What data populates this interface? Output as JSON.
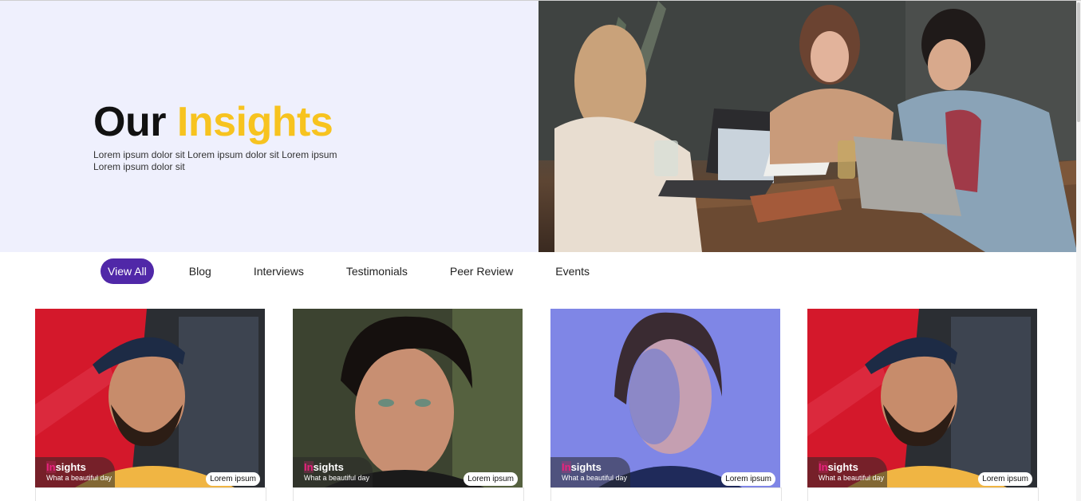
{
  "hero": {
    "title_prefix": "Our",
    "title_accent": "Insights",
    "description": "Lorem ipsum dolor sit Lorem ipsum dolor sit Lorem ipsum Lorem ipsum dolor sit"
  },
  "tabs": [
    {
      "label": "View All",
      "active": true
    },
    {
      "label": "Blog"
    },
    {
      "label": "Interviews"
    },
    {
      "label": "Testimonials"
    },
    {
      "label": "Peer Review"
    },
    {
      "label": "Events"
    }
  ],
  "cards": [
    {
      "title_first": "In",
      "title_rest": "sights",
      "subtitle": "What a beautiful day",
      "pill": "Lorem ipsum"
    },
    {
      "title_first": "In",
      "title_rest": "sights",
      "subtitle": "What a beautiful day",
      "pill": "Lorem ipsum"
    },
    {
      "title_first": "In",
      "title_rest": "sights",
      "subtitle": "What a beautiful day",
      "pill": "Lorem ipsum"
    },
    {
      "title_first": "In",
      "title_rest": "sights",
      "subtitle": "What a beautiful day",
      "pill": "Lorem ipsum"
    }
  ],
  "colors": {
    "accent_yellow": "#f7c31f",
    "tab_active": "#5028a8",
    "hero_bg": "#eff0fd",
    "badge_highlight": "#e7247d"
  }
}
